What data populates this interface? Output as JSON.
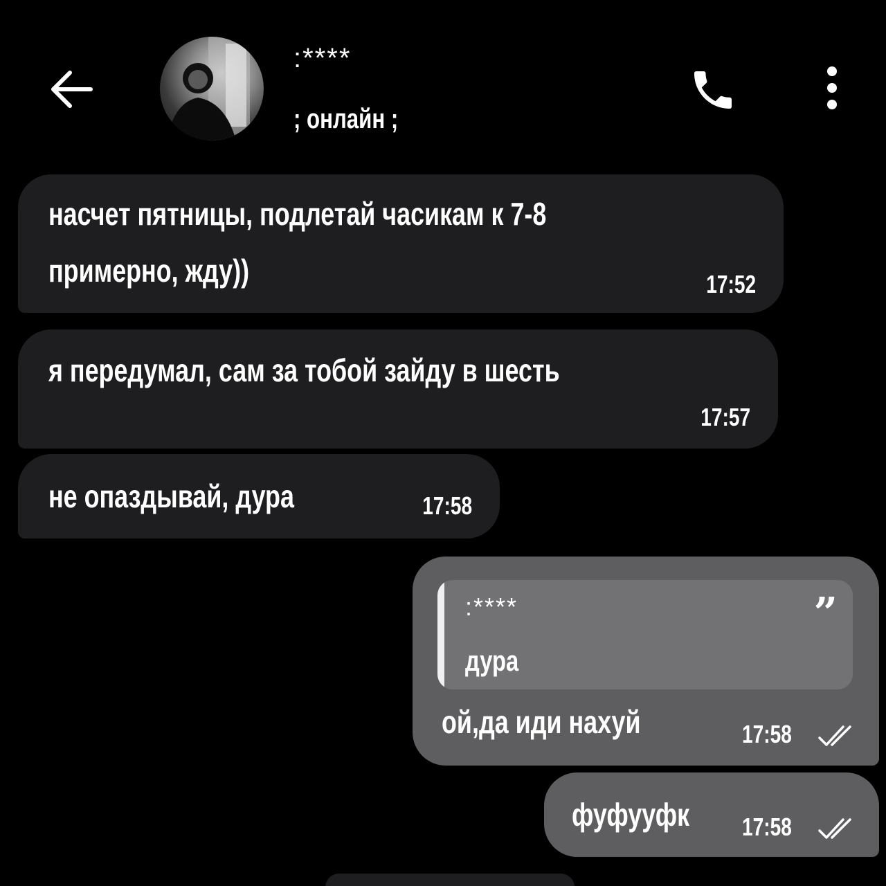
{
  "header": {
    "contact_name": ":****",
    "status": "; онлайн ;",
    "icons": {
      "back": "arrow-left-icon",
      "call": "phone-icon",
      "menu": "more-vertical-icon"
    }
  },
  "messages": [
    {
      "direction": "incoming",
      "lines": [
        "насчет пятницы, подлетай часикам к 7-8",
        "примерно, жду))"
      ],
      "time": "17:52"
    },
    {
      "direction": "incoming",
      "lines": [
        "я передумал, сам за тобой зайду в шесть"
      ],
      "time": "17:57"
    },
    {
      "direction": "incoming",
      "lines": [
        "не опаздывай, дура"
      ],
      "time": "17:58"
    },
    {
      "direction": "outgoing",
      "reply": {
        "author": ":****",
        "text": "дура",
        "quote_mark": "”"
      },
      "lines": [
        "ой,да иди нахуй"
      ],
      "time": "17:58",
      "status_icon": "double-check-icon"
    },
    {
      "direction": "outgoing",
      "lines": [
        "фуфууфк"
      ],
      "time": "17:58",
      "status_icon": "double-check-icon"
    }
  ]
}
